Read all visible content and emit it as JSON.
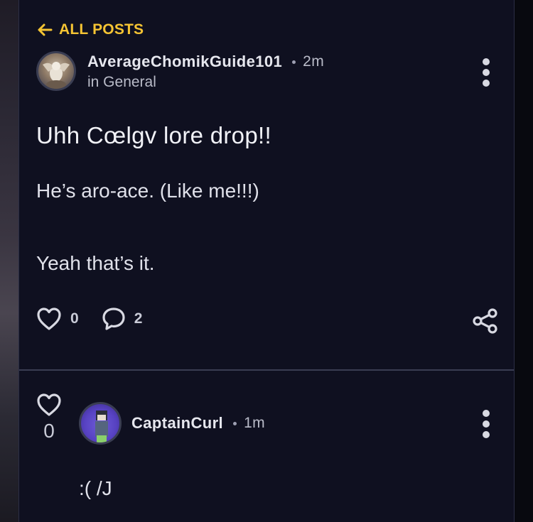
{
  "nav": {
    "back_label": "ALL POSTS",
    "back_icon": "arrow-left-icon"
  },
  "post": {
    "author": "AverageChomikGuide101",
    "time": "2m",
    "category": "in General",
    "title": "Uhh Cœlgv lore drop!!",
    "body": [
      "He’s aro-ace. (Like me!!!)",
      "Yeah that’s it."
    ],
    "likes": "0",
    "comments": "2",
    "icons": {
      "like": "heart-icon",
      "comment": "comment-bubble-icon",
      "share": "share-icon",
      "menu": "kebab-menu-icon"
    }
  },
  "comment": {
    "author": "CaptainCurl",
    "time": "1m",
    "text": ":( /J",
    "likes": "0"
  },
  "colors": {
    "accent": "#f5c433",
    "panel_bg": "#0f1020",
    "text": "#e6e7ee",
    "muted": "#b9bbc8",
    "border": "#3a3d52"
  }
}
